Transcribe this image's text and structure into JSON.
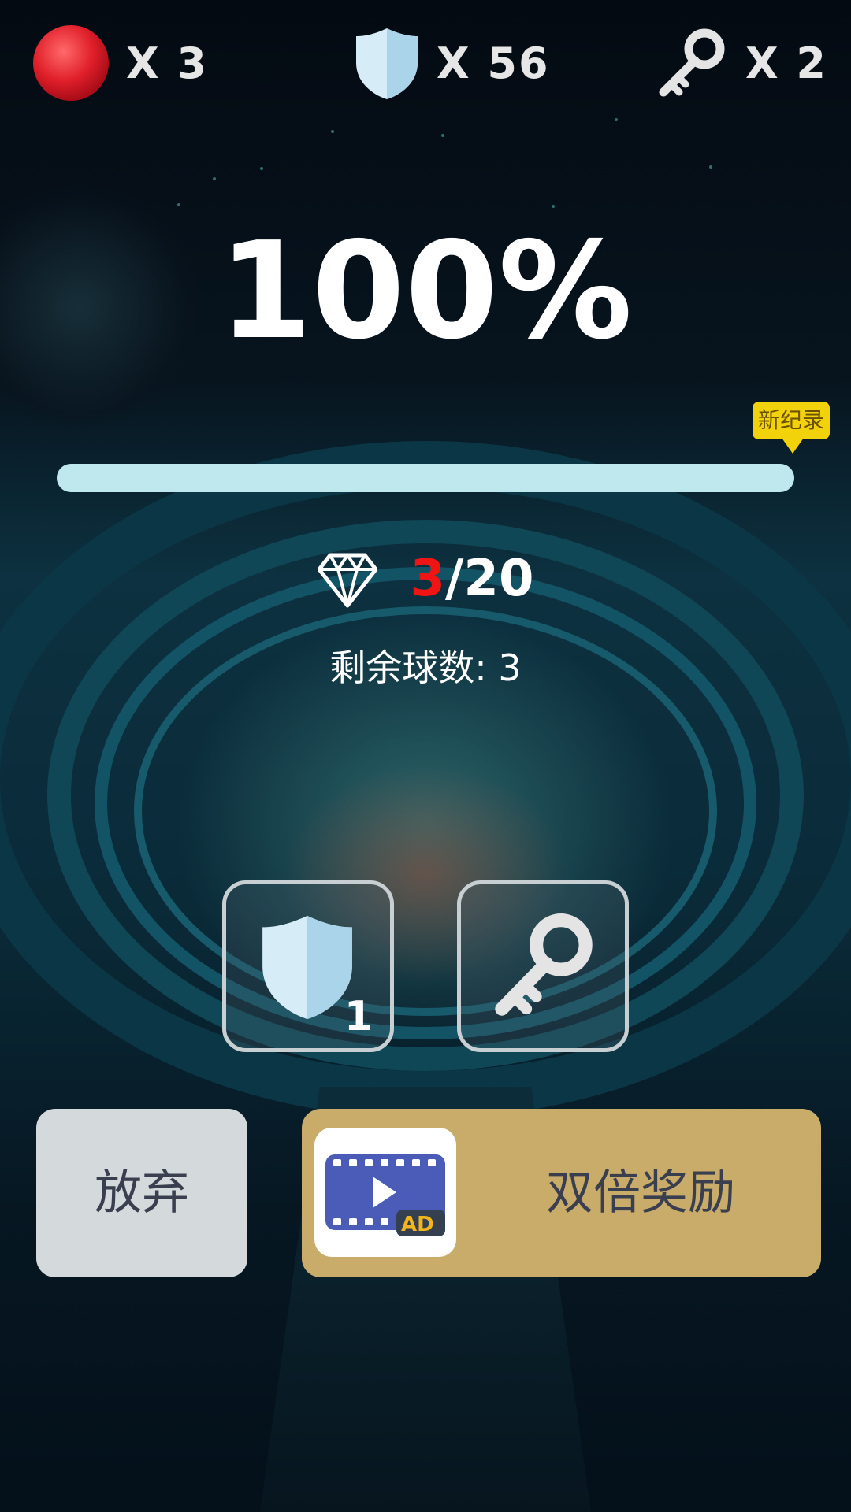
{
  "hud": {
    "lives": {
      "icon": "red-ball-icon",
      "count_text": "X 3"
    },
    "shields": {
      "icon": "shield-icon",
      "count_text": "X 56"
    },
    "keys": {
      "icon": "key-icon",
      "count_text": "X 2"
    }
  },
  "result": {
    "percent_text": "100%",
    "progress": 1.0,
    "record_badge": "新纪录"
  },
  "gems": {
    "icon": "diamond-icon",
    "current": "3",
    "total": "/20"
  },
  "remaining_balls_text": "剩余球数: 3",
  "powerups": [
    {
      "name": "shield",
      "icon": "shield-icon",
      "count": "1"
    },
    {
      "name": "key",
      "icon": "key-icon"
    }
  ],
  "buttons": {
    "quit_label": "放弃",
    "double_reward_label": "双倍奖励",
    "ad_badge": "AD"
  },
  "colors": {
    "progress_fill": "#bfe8ee",
    "gem_current": "#f01515",
    "double_button": "#c9ac6a",
    "quit_button": "#d4d9db",
    "record_badge": "#f2d20a"
  }
}
